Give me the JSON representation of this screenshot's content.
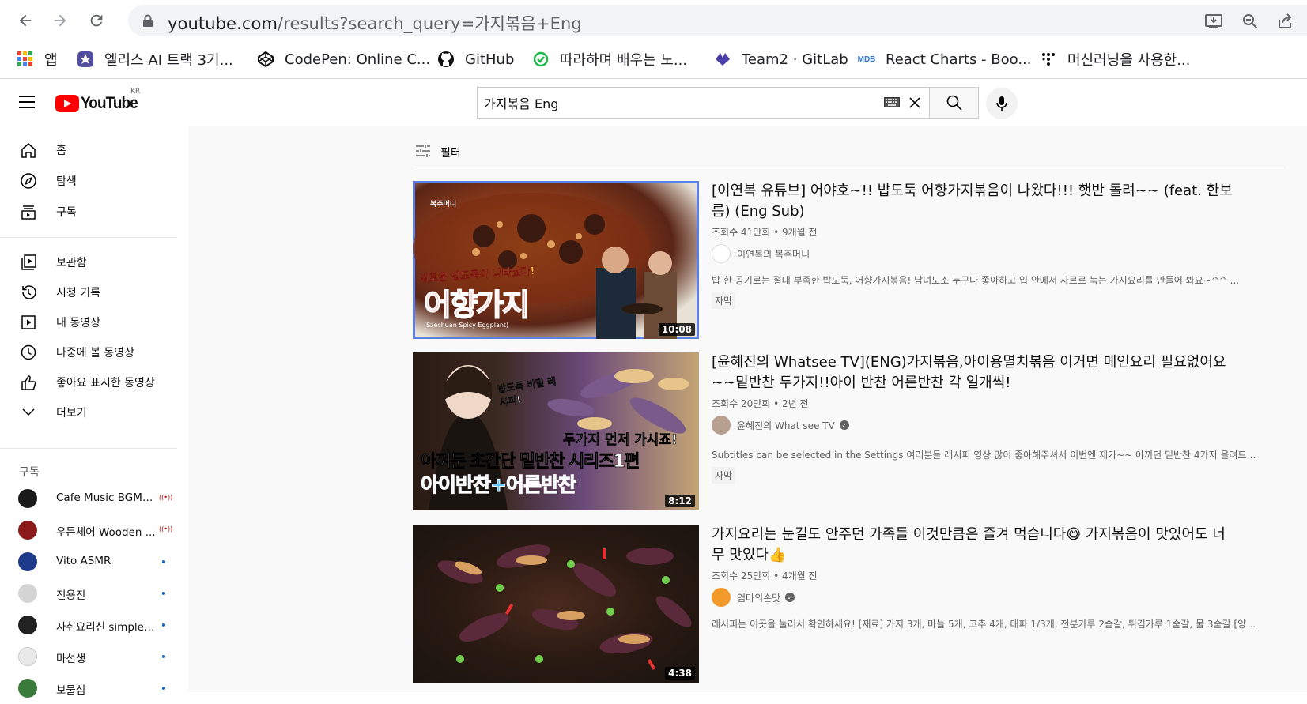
{
  "browser": {
    "url_domain": "youtube.com",
    "url_path": "/results?search_query=가지볶음+Eng",
    "bookmarks": [
      {
        "label": "앱",
        "icon": "apps-grid-icon"
      },
      {
        "label": "엘리스 AI 트랙 3기...",
        "icon": "elice-icon"
      },
      {
        "label": "CodePen: Online C...",
        "icon": "codepen-icon"
      },
      {
        "label": "GitHub",
        "icon": "github-icon"
      },
      {
        "label": "따라하며 배우는 노...",
        "icon": "course-icon"
      },
      {
        "label": "Team2 · GitLab",
        "icon": "gitlab-icon"
      },
      {
        "label": "React Charts - Boo...",
        "icon": "mdb-icon"
      },
      {
        "label": "머신러닝을 사용한...",
        "icon": "tensorflow-icon"
      }
    ]
  },
  "header": {
    "logo_text": "YouTube",
    "region": "KR",
    "search_value": "가지볶음 Eng"
  },
  "sidebar": {
    "primary": [
      {
        "label": "홈",
        "icon": "home-icon"
      },
      {
        "label": "탐색",
        "icon": "explore-icon"
      },
      {
        "label": "구독",
        "icon": "subscriptions-icon"
      }
    ],
    "library": [
      {
        "label": "보관함",
        "icon": "library-icon"
      },
      {
        "label": "시청 기록",
        "icon": "history-icon"
      },
      {
        "label": "내 동영상",
        "icon": "your-videos-icon"
      },
      {
        "label": "나중에 볼 동영상",
        "icon": "watch-later-icon"
      },
      {
        "label": "좋아요 표시한 동영상",
        "icon": "liked-icon"
      },
      {
        "label": "더보기",
        "icon": "chevron-down-icon"
      }
    ],
    "subscriptions_heading": "구독",
    "subscriptions": [
      {
        "label": "Cafe Music BGM c...",
        "status": "live",
        "color": "#1a1a1a"
      },
      {
        "label": "우든체어 Wooden ...",
        "status": "live",
        "color": "#8b1a1a"
      },
      {
        "label": "Vito ASMR",
        "status": "new",
        "color": "#1e3a8a"
      },
      {
        "label": "진용진",
        "status": "new",
        "color": "#d4d4d4"
      },
      {
        "label": "자취요리신 simple ...",
        "status": "new",
        "color": "#222222"
      },
      {
        "label": "마선생",
        "status": "new",
        "color": "#f2f2f2"
      },
      {
        "label": "보물섬",
        "status": "new",
        "color": "#3a7a3a"
      }
    ]
  },
  "filter": {
    "label": "필터"
  },
  "results": [
    {
      "title": "[이연복 유튜브] 어야호~!! 밥도둑 어향가지볶음이 나왔다!!! 햇반 돌려~~ (feat. 한보름) (Eng Sub)",
      "meta": "조회수 41만회 • 9개월 전",
      "channel": "이연복의 복주머니",
      "verified": false,
      "description": "밥 한 공기로는 절대 부족한 밥도둑, 어향가지볶음! 남녀노소 누구나 좋아하고 입 안에서 사르르 녹는 가지요리를 만들어 봐요~^^ ...",
      "badge": "자막",
      "duration": "10:08",
      "thumb_texts": [
        "복주머니",
        "새로운 밥도둑이 나타났다!",
        "어향가지",
        "(Szechuan Spicy Eggplant)"
      ]
    },
    {
      "title": "[윤혜진의 Whatsee TV](ENG)가지볶음,아이용멸치볶음 이거면 메인요리 필요없어요~~밑반찬 두가지!!아이 반찬 어른반찬 각 일개씩!",
      "meta": "조회수 20만회 • 2년 전",
      "channel": "윤혜진의 What see TV",
      "verified": true,
      "description": "Subtitles can be selected in the Settings 여러분들 레시피 영상 많이 좋아해주셔서 이번엔 제가~~ 아끼던 밑반찬 4가지 올려드렸 ...",
      "badge": "자막",
      "duration": "8:12",
      "thumb_texts": [
        "밥도둑 비밀 레시피!",
        "두가지 먼저 가시죠!",
        "아껴둔 초간단 밑반찬 시리즈1편",
        "아이반찬+어른반찬"
      ]
    },
    {
      "title": "가지요리는 눈길도 안주던 가족들 이것만큼은 즐겨 먹습니다😋 가지볶음이 맛있어도 너무 맛있다👍",
      "meta": "조회수 25만회 • 4개월 전",
      "channel": "엄마의손맛",
      "verified": true,
      "description": "레시피는 이곳을 눌러서 확인하세요! [재료] 가지 3개, 마늘 5개, 고추 4개, 대파 1/3개, 전분가루 2숟갈, 튀김가루 1숟갈, 물 3숟갈 [양념] ...",
      "badge": "",
      "duration": "4:38",
      "thumb_texts": []
    }
  ]
}
